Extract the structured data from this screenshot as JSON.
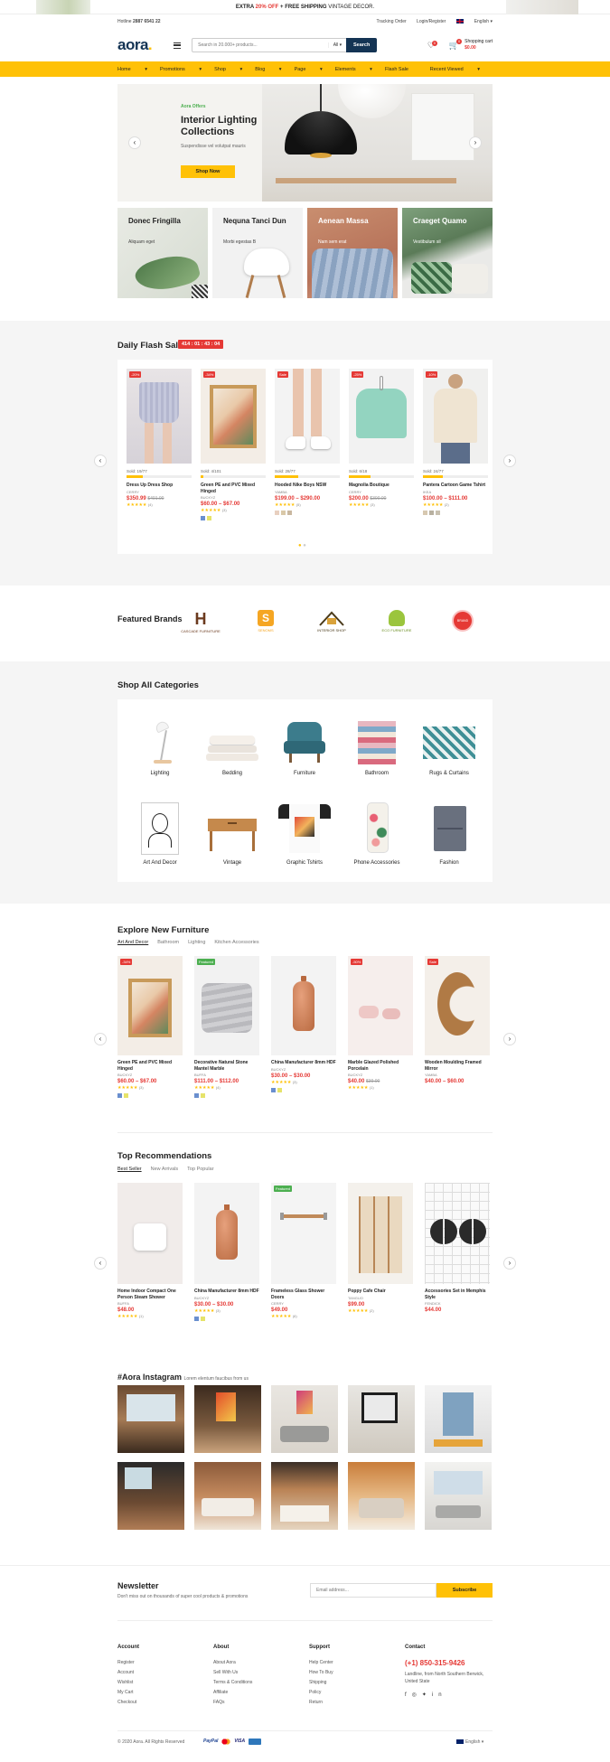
{
  "promo": {
    "text_a": "EXTRA ",
    "percent": "20% OFF",
    "text_b": " + FREE SHIPPING",
    "text_c": " VINTAGE DECOR."
  },
  "topbar": {
    "hotline": "Hotline ",
    "phone": "2887 6541 22",
    "tracking": "Tracking Order",
    "login": "Login/Register",
    "language": "English"
  },
  "header": {
    "logo": "aora",
    "search_placeholder": "Search in 20.000+ products...",
    "category": "All",
    "search_button": "Search",
    "cart_label": "Shopping cart",
    "cart_total": "$0.00",
    "wishlist_count": "0",
    "cart_count": "0"
  },
  "nav": {
    "items": [
      "Home",
      "Promotions",
      "Shop",
      "Blog",
      "Page",
      "Elements",
      "Flash Sale"
    ],
    "recent": "Recent Viewed"
  },
  "hero": {
    "offer": "Aora Offers",
    "title": "Interior Lighting Collections",
    "subtitle": "Suspendisse vel volutpat mauris",
    "button": "Shop Now"
  },
  "banners": [
    {
      "title": "Donec Fringilla",
      "sub": "Aliquam eget"
    },
    {
      "title": "Nequna Tanci Dun",
      "sub": "Morbi egestas B"
    },
    {
      "title": "Aenean Massa",
      "sub": "Nam sem erat"
    },
    {
      "title": "Craeget Quamo",
      "sub": "Vestibulum sil"
    }
  ],
  "flash": {
    "title": "Daily Flash Sale",
    "timer": "414 : 01 : 43 : 04",
    "products": [
      {
        "tag": "-20%",
        "sold": "Sold: 19/77",
        "progress": 0.25,
        "name": "Dress Up Dress Shop",
        "brand": "CERRY",
        "price": "$350.99",
        "old": "$401.00",
        "reviews": "(4)"
      },
      {
        "tag": "-34%",
        "sold": "Sold: 4/101",
        "progress": 0.04,
        "name": "Green PE and PVC Mixed Hinged",
        "brand": "BUCKYZ",
        "price": "$60.00 – $67.00",
        "old": "",
        "reviews": "(3)"
      },
      {
        "tag": "Sale",
        "sold": "Sold: 28/77",
        "progress": 0.36,
        "name": "Hooded Nike Boys NSW",
        "brand": "YAMBA",
        "price": "$199.00 – $290.00",
        "old": "",
        "reviews": "(5)"
      },
      {
        "tag": "-25%",
        "sold": "Sold: 6/18",
        "progress": 0.33,
        "name": "Magnolia Boutique",
        "brand": "CERRY",
        "price": "$200.00",
        "old": "$300.00",
        "reviews": "(3)"
      },
      {
        "tag": "-10%",
        "sold": "Sold: 24/77",
        "progress": 0.31,
        "name": "Pantera Cartoon Game Tshirt",
        "brand": "IKEA",
        "price": "$100.00 – $111.00",
        "old": "",
        "reviews": "(2)"
      }
    ]
  },
  "brands": {
    "title": "Featured Brands",
    "logos": [
      "CASCADE FURNITURE",
      "SENOMS",
      "INTERIOR SHOP",
      "ECO FURNITURE",
      "BRAND"
    ]
  },
  "categories": {
    "title": "Shop All Categories",
    "items": [
      "Lighting",
      "Bedding",
      "Furniture",
      "Bathroom",
      "Rugs & Curtains",
      "Art And Decor",
      "Vintage",
      "Graphic Tshirts",
      "Phone Accessories",
      "Fashion"
    ]
  },
  "explore": {
    "title": "Explore New Furniture",
    "tabs": [
      "Art And Decor",
      "Bathroom",
      "Lighting",
      "Kitchen Accessories"
    ],
    "products": [
      {
        "tag": "-34%",
        "name": "Green PE and PVC Mixed Hinged",
        "brand": "BUCKYZ",
        "price": "$60.00 – $67.00",
        "old": "",
        "reviews": "(3)"
      },
      {
        "tag": "Featured",
        "name": "Decorative Natural Stone Mantel Marble",
        "brand": "BUFFA",
        "price": "$111.00 – $112.00",
        "old": "",
        "reviews": "(4)"
      },
      {
        "tag": "",
        "name": "China Manufacturer 8mm HDF",
        "brand": "BUCKYZ",
        "price": "$30.00 – $30.00",
        "old": "",
        "reviews": "(3)"
      },
      {
        "tag": "-50%",
        "name": "Marble Glazed Polished Porcelain",
        "brand": "BUCKYZ",
        "price": "$40.00",
        "old": "$39.00",
        "reviews": "(1)"
      },
      {
        "tag": "Sale",
        "name": "Wooden Moulding Framed Mirror",
        "brand": "YAMBA",
        "price": "$40.00 – $60.00",
        "old": "",
        "reviews": ""
      }
    ]
  },
  "recommend": {
    "title": "Top Recommendations",
    "tabs": [
      "Best Seller",
      "New Arrivals",
      "Top Popular"
    ],
    "products": [
      {
        "tag": "",
        "name": "Home Indoor Compact One Person Steam Shower",
        "brand": "BUFFA",
        "price": "$48.00",
        "old": "",
        "reviews": "(1)"
      },
      {
        "tag": "",
        "name": "China Manufacturer 8mm HDF",
        "brand": "BUCKYZ",
        "price": "$30.00 – $30.00",
        "old": "",
        "reviews": "(3)"
      },
      {
        "tag": "Featured",
        "name": "Frameless Glass Shower Doors",
        "brand": "CERRY",
        "price": "$49.00",
        "old": "",
        "reviews": "(6)"
      },
      {
        "tag": "",
        "name": "Poppy Cafe Chair",
        "brand": "TANGUO",
        "price": "$99.00",
        "old": "",
        "reviews": "(2)"
      },
      {
        "tag": "",
        "name": "Accessories Set in Memphis Style",
        "brand": "FENDICK",
        "price": "$44.00",
        "old": "",
        "reviews": ""
      }
    ]
  },
  "instagram": {
    "title": "#Aora Instagram",
    "subtitle": "Lorem elentum faucibus from us"
  },
  "newsletter": {
    "title": "Newsletter",
    "subtitle": "Don't miss out on thousands of super cool products & promotions",
    "placeholder": "Email address...",
    "button": "Subscribe"
  },
  "footer": {
    "account": {
      "title": "Account",
      "links": [
        "Register",
        "Account",
        "Wishlist",
        "My Cart",
        "Checkout"
      ]
    },
    "about": {
      "title": "About",
      "links": [
        "About Aora",
        "Sell With Us",
        "Terms & Conditions",
        "Affiliate",
        "FAQs"
      ]
    },
    "support": {
      "title": "Support",
      "links": [
        "Help Center",
        "How To Buy",
        "Shipping",
        "Policy",
        "Return"
      ]
    },
    "contact": {
      "title": "Contact",
      "phone": "(+1) 850-315-9426",
      "address": "Landline, from North Southern Berwick, United State"
    },
    "copyright": "© 2020 Aora. All Rights Reserved",
    "language": "English"
  },
  "colors": {
    "accent": "#ffc107",
    "navy": "#143454",
    "sale": "#e53935",
    "featured": "#4caf50"
  }
}
